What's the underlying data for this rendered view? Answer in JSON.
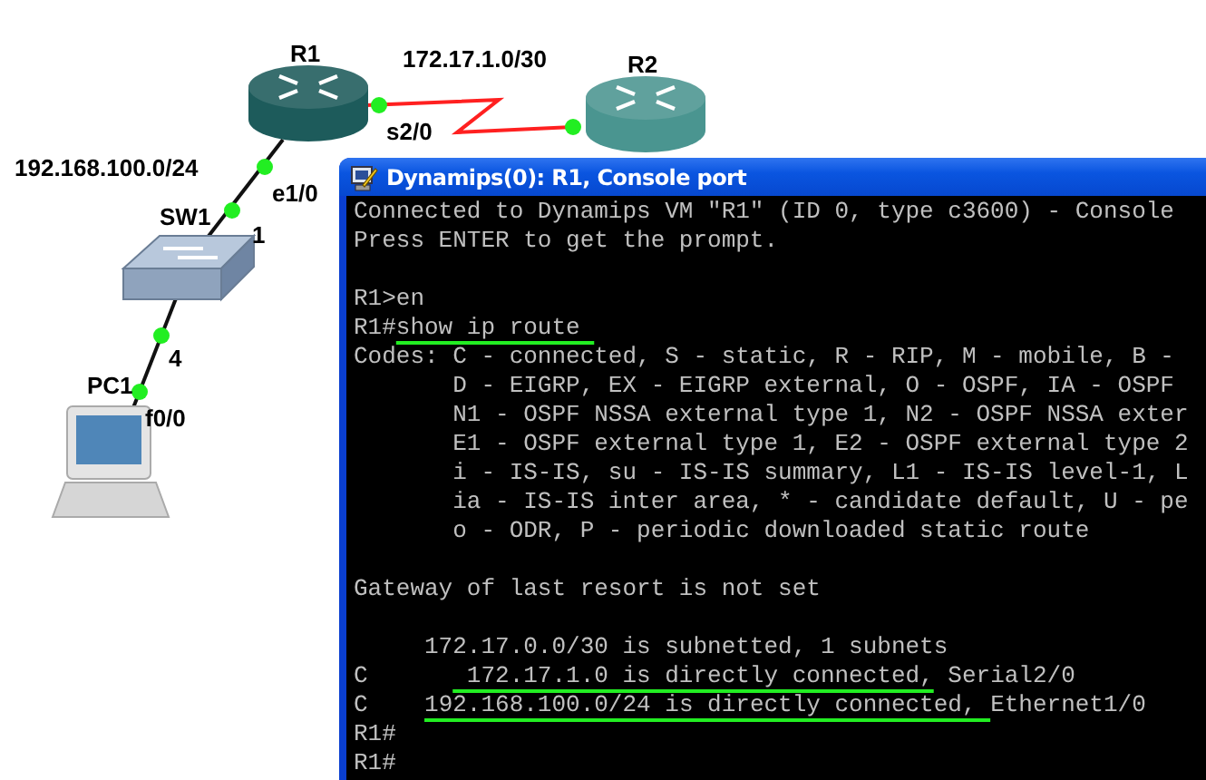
{
  "topology": {
    "devices": [
      {
        "name": "R1",
        "kind": "router",
        "color": "#1d5b5b"
      },
      {
        "name": "R2",
        "kind": "router",
        "color": "#4a9590"
      },
      {
        "name": "SW1",
        "kind": "switch"
      },
      {
        "name": "PC1",
        "kind": "pc"
      }
    ],
    "links": [
      {
        "kind": "serial",
        "network": "172.17.1.0/30",
        "ports": [
          "s2/0"
        ]
      },
      {
        "kind": "ethernet",
        "network": "192.168.100.0/24",
        "ports": [
          "e1/0",
          "1"
        ]
      },
      {
        "kind": "ethernet",
        "ports": [
          "4",
          "f0/0"
        ]
      }
    ]
  },
  "console": {
    "title": "Dynamips(0): R1, Console port",
    "lines": [
      {
        "kind": "text",
        "text": "Connected to Dynamips VM \"R1\" (ID 0, type c3600) - Console"
      },
      {
        "kind": "text",
        "text": "Press ENTER to get the prompt."
      },
      {
        "kind": "blank"
      },
      {
        "kind": "text",
        "text": "R1>en"
      },
      {
        "kind": "marked",
        "parts": [
          {
            "text": "R1#",
            "underlined": false
          },
          {
            "text": "show ip route ",
            "underlined": true
          }
        ]
      },
      {
        "kind": "text",
        "text": "Codes: C - connected, S - static, R - RIP, M - mobile, B -"
      },
      {
        "kind": "text",
        "text": "       D - EIGRP, EX - EIGRP external, O - OSPF, IA - OSPF"
      },
      {
        "kind": "text",
        "text": "       N1 - OSPF NSSA external type 1, N2 - OSPF NSSA exter"
      },
      {
        "kind": "text",
        "text": "       E1 - OSPF external type 1, E2 - OSPF external type 2"
      },
      {
        "kind": "text",
        "text": "       i - IS-IS, su - IS-IS summary, L1 - IS-IS level-1, L"
      },
      {
        "kind": "text",
        "text": "       ia - IS-IS inter area, * - candidate default, U - pe"
      },
      {
        "kind": "text",
        "text": "       o - ODR, P - periodic downloaded static route"
      },
      {
        "kind": "blank"
      },
      {
        "kind": "text",
        "text": "Gateway of last resort is not set"
      },
      {
        "kind": "blank"
      },
      {
        "kind": "text",
        "text": "     172.17.0.0/30 is subnetted, 1 subnets"
      },
      {
        "kind": "marked",
        "parts": [
          {
            "text": "C      ",
            "underlined": false
          },
          {
            "text": " 172.17.1.0 is directly connected,",
            "underlined": true
          },
          {
            "text": " Serial2/0",
            "underlined": false
          }
        ]
      },
      {
        "kind": "marked",
        "parts": [
          {
            "text": "C    ",
            "underlined": false
          },
          {
            "text": "192.168.100.0/24 is directly connected, ",
            "underlined": true
          },
          {
            "text": "Ethernet1/0",
            "underlined": false
          }
        ]
      },
      {
        "kind": "text",
        "text": "R1#"
      },
      {
        "kind": "text",
        "text": "R1#"
      }
    ]
  }
}
